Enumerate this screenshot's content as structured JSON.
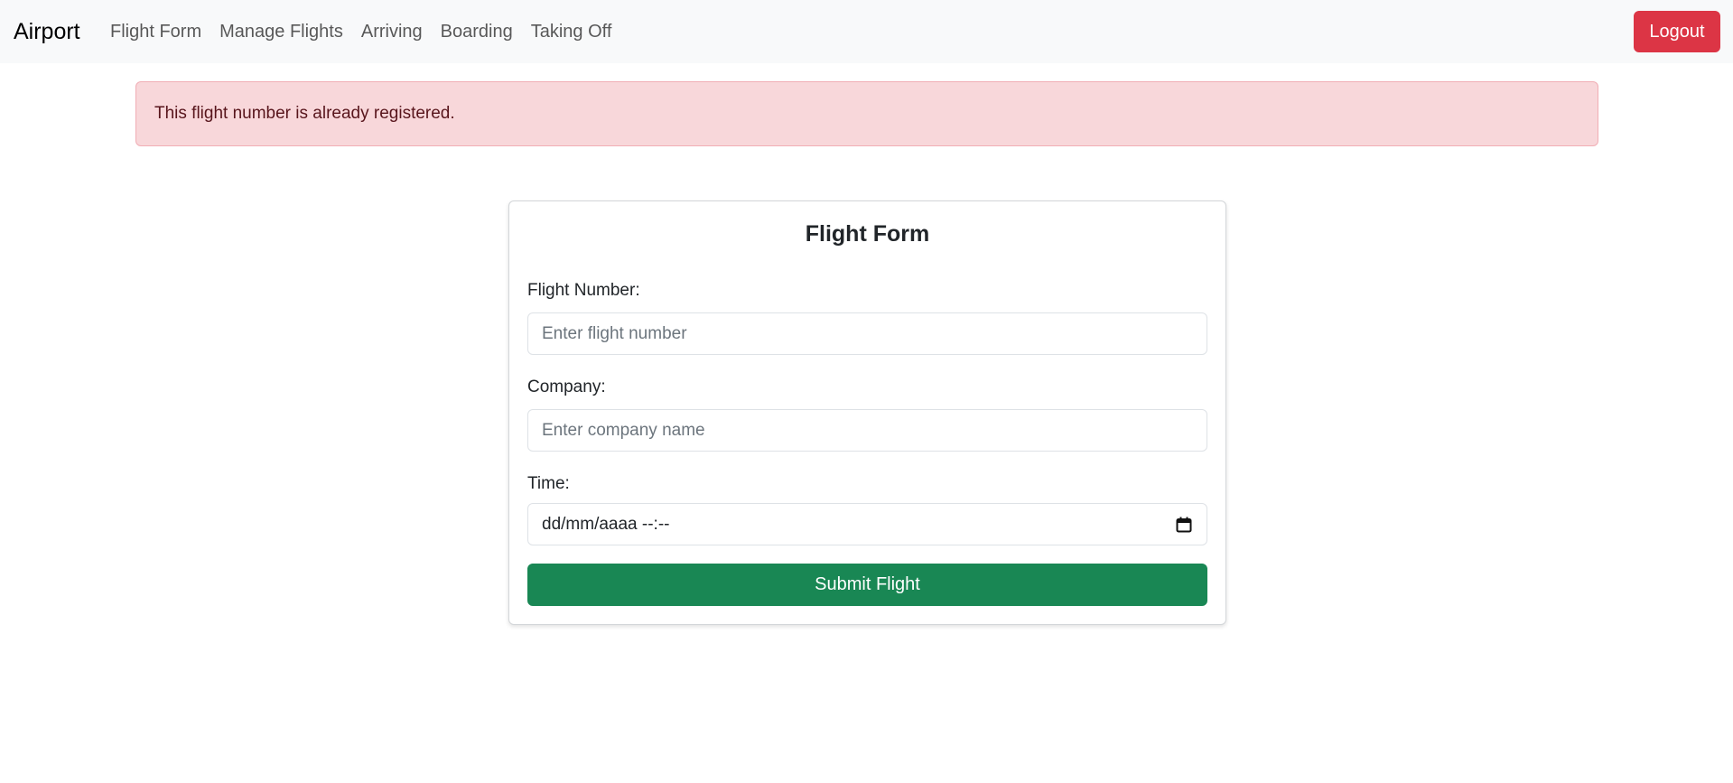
{
  "navbar": {
    "brand": "Airport",
    "links": [
      {
        "label": "Flight Form"
      },
      {
        "label": "Manage Flights"
      },
      {
        "label": "Arriving"
      },
      {
        "label": "Boarding"
      },
      {
        "label": "Taking Off"
      }
    ],
    "logout_label": "Logout"
  },
  "alert": {
    "message": "This flight number is already registered."
  },
  "form": {
    "title": "Flight Form",
    "flight_number": {
      "label": "Flight Number:",
      "value": "",
      "placeholder": "Enter flight number"
    },
    "company": {
      "label": "Company:",
      "value": "",
      "placeholder": "Enter company name"
    },
    "time": {
      "label": "Time:",
      "display": "dd/mm/aaaa --:--",
      "icon": "calendar-icon"
    },
    "submit_label": "Submit Flight"
  },
  "colors": {
    "navbar_bg": "#f8f9fa",
    "logout": "#dc3545",
    "alert_bg": "#f8d7da",
    "alert_text": "#58151c",
    "submit": "#198754"
  }
}
